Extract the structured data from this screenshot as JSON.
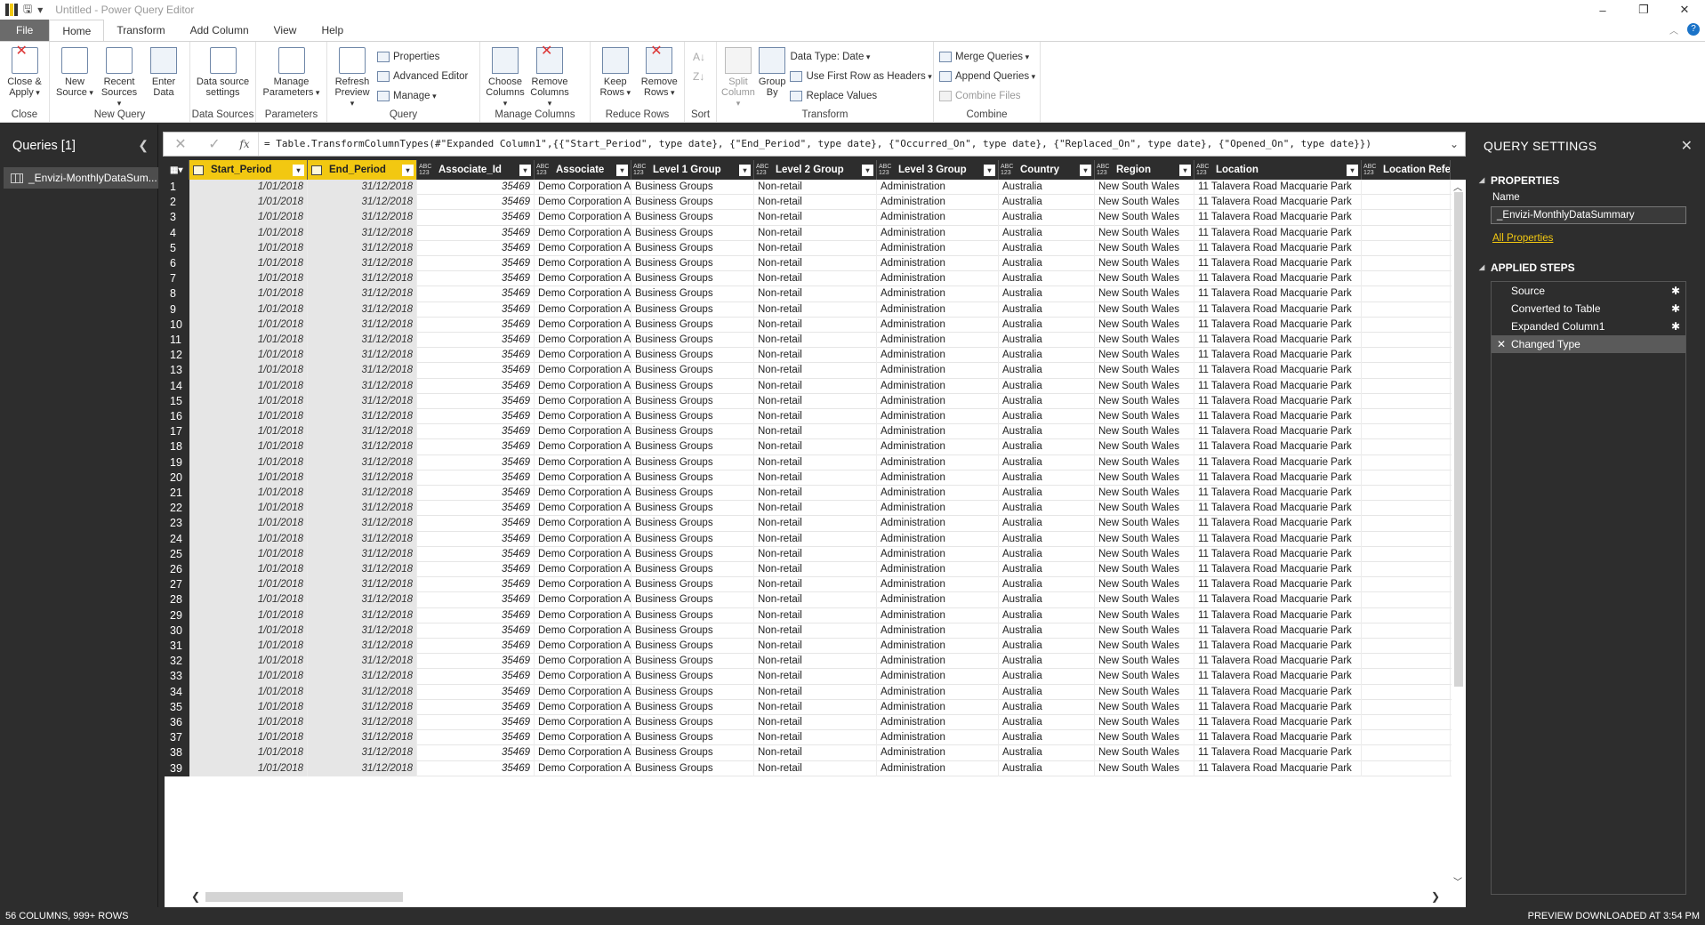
{
  "window": {
    "title": "Untitled - Power Query Editor",
    "save_icon": "save-icon",
    "undo": "▾",
    "buttons": [
      "–",
      "❐",
      "✕"
    ]
  },
  "tabs": [
    "File",
    "Home",
    "Transform",
    "Add Column",
    "View",
    "Help"
  ],
  "ribbon": {
    "close": {
      "label1": "Close &",
      "label2": "Apply",
      "group": "Close"
    },
    "new_source": {
      "label1": "New",
      "label2": "Source"
    },
    "recent_sources": {
      "label1": "Recent",
      "label2": "Sources"
    },
    "enter_data": {
      "label1": "Enter",
      "label2": "Data"
    },
    "new_query_group": "New Query",
    "data_source_settings": {
      "label1": "Data source",
      "label2": "settings"
    },
    "data_sources_group": "Data Sources",
    "manage_parameters": {
      "label1": "Manage",
      "label2": "Parameters"
    },
    "parameters_group": "Parameters",
    "refresh_preview": {
      "label1": "Refresh",
      "label2": "Preview"
    },
    "properties": "Properties",
    "advanced_editor": "Advanced Editor",
    "manage": "Manage",
    "query_group": "Query",
    "choose_columns": {
      "label1": "Choose",
      "label2": "Columns"
    },
    "remove_columns": {
      "label1": "Remove",
      "label2": "Columns"
    },
    "manage_columns_group": "Manage Columns",
    "keep_rows": {
      "label1": "Keep",
      "label2": "Rows"
    },
    "remove_rows": {
      "label1": "Remove",
      "label2": "Rows"
    },
    "reduce_rows_group": "Reduce Rows",
    "sort_group": "Sort",
    "split_column": {
      "label1": "Split",
      "label2": "Column"
    },
    "group_by": {
      "label1": "Group",
      "label2": "By"
    },
    "data_type": "Data Type: Date",
    "use_first_row": "Use First Row as Headers",
    "replace_values": "Replace Values",
    "transform_group": "Transform",
    "merge_queries": "Merge Queries",
    "append_queries": "Append Queries",
    "combine_files": "Combine Files",
    "combine_group": "Combine"
  },
  "queries": {
    "header": "Queries [1]",
    "items": [
      "_Envizi-MonthlyDataSum..."
    ]
  },
  "formula": {
    "text": "= Table.TransformColumnTypes(#\"Expanded Column1\",{{\"Start_Period\", type date}, {\"End_Period\", type date}, {\"Occurred_On\", type date}, {\"Replaced_On\", type date}, {\"Opened_On\", type date}})"
  },
  "columns": [
    {
      "name": "Start_Period",
      "type": "cal"
    },
    {
      "name": "End_Period",
      "type": "cal"
    },
    {
      "name": "Associate_Id",
      "type": "ABC\n123"
    },
    {
      "name": "Associate",
      "type": "ABC\n123"
    },
    {
      "name": "Level 1 Group",
      "type": "ABC\n123"
    },
    {
      "name": "Level 2 Group",
      "type": "ABC\n123"
    },
    {
      "name": "Level 3 Group",
      "type": "ABC\n123"
    },
    {
      "name": "Country",
      "type": "ABC\n123"
    },
    {
      "name": "Region",
      "type": "ABC\n123"
    },
    {
      "name": "Location",
      "type": "ABC\n123"
    },
    {
      "name": "Location Refer",
      "type": "ABC\n123"
    }
  ],
  "row_template": [
    "1/01/2018",
    "31/12/2018",
    "35469",
    "Demo Corporation AU",
    "Business Groups",
    "Non-retail",
    "Administration",
    "Australia",
    "New South Wales",
    "11 Talavera Road Macquarie Park",
    ""
  ],
  "row_count": 39,
  "settings": {
    "title": "QUERY SETTINGS",
    "properties": "PROPERTIES",
    "name_label": "Name",
    "name_value": "_Envizi-MonthlyDataSummary",
    "all_properties": "All Properties",
    "applied_steps": "APPLIED STEPS",
    "steps": [
      "Source",
      "Converted to Table",
      "Expanded Column1",
      "Changed Type"
    ]
  },
  "status": {
    "left": "56 COLUMNS, 999+ ROWS",
    "right": "PREVIEW DOWNLOADED AT 3:54 PM"
  }
}
